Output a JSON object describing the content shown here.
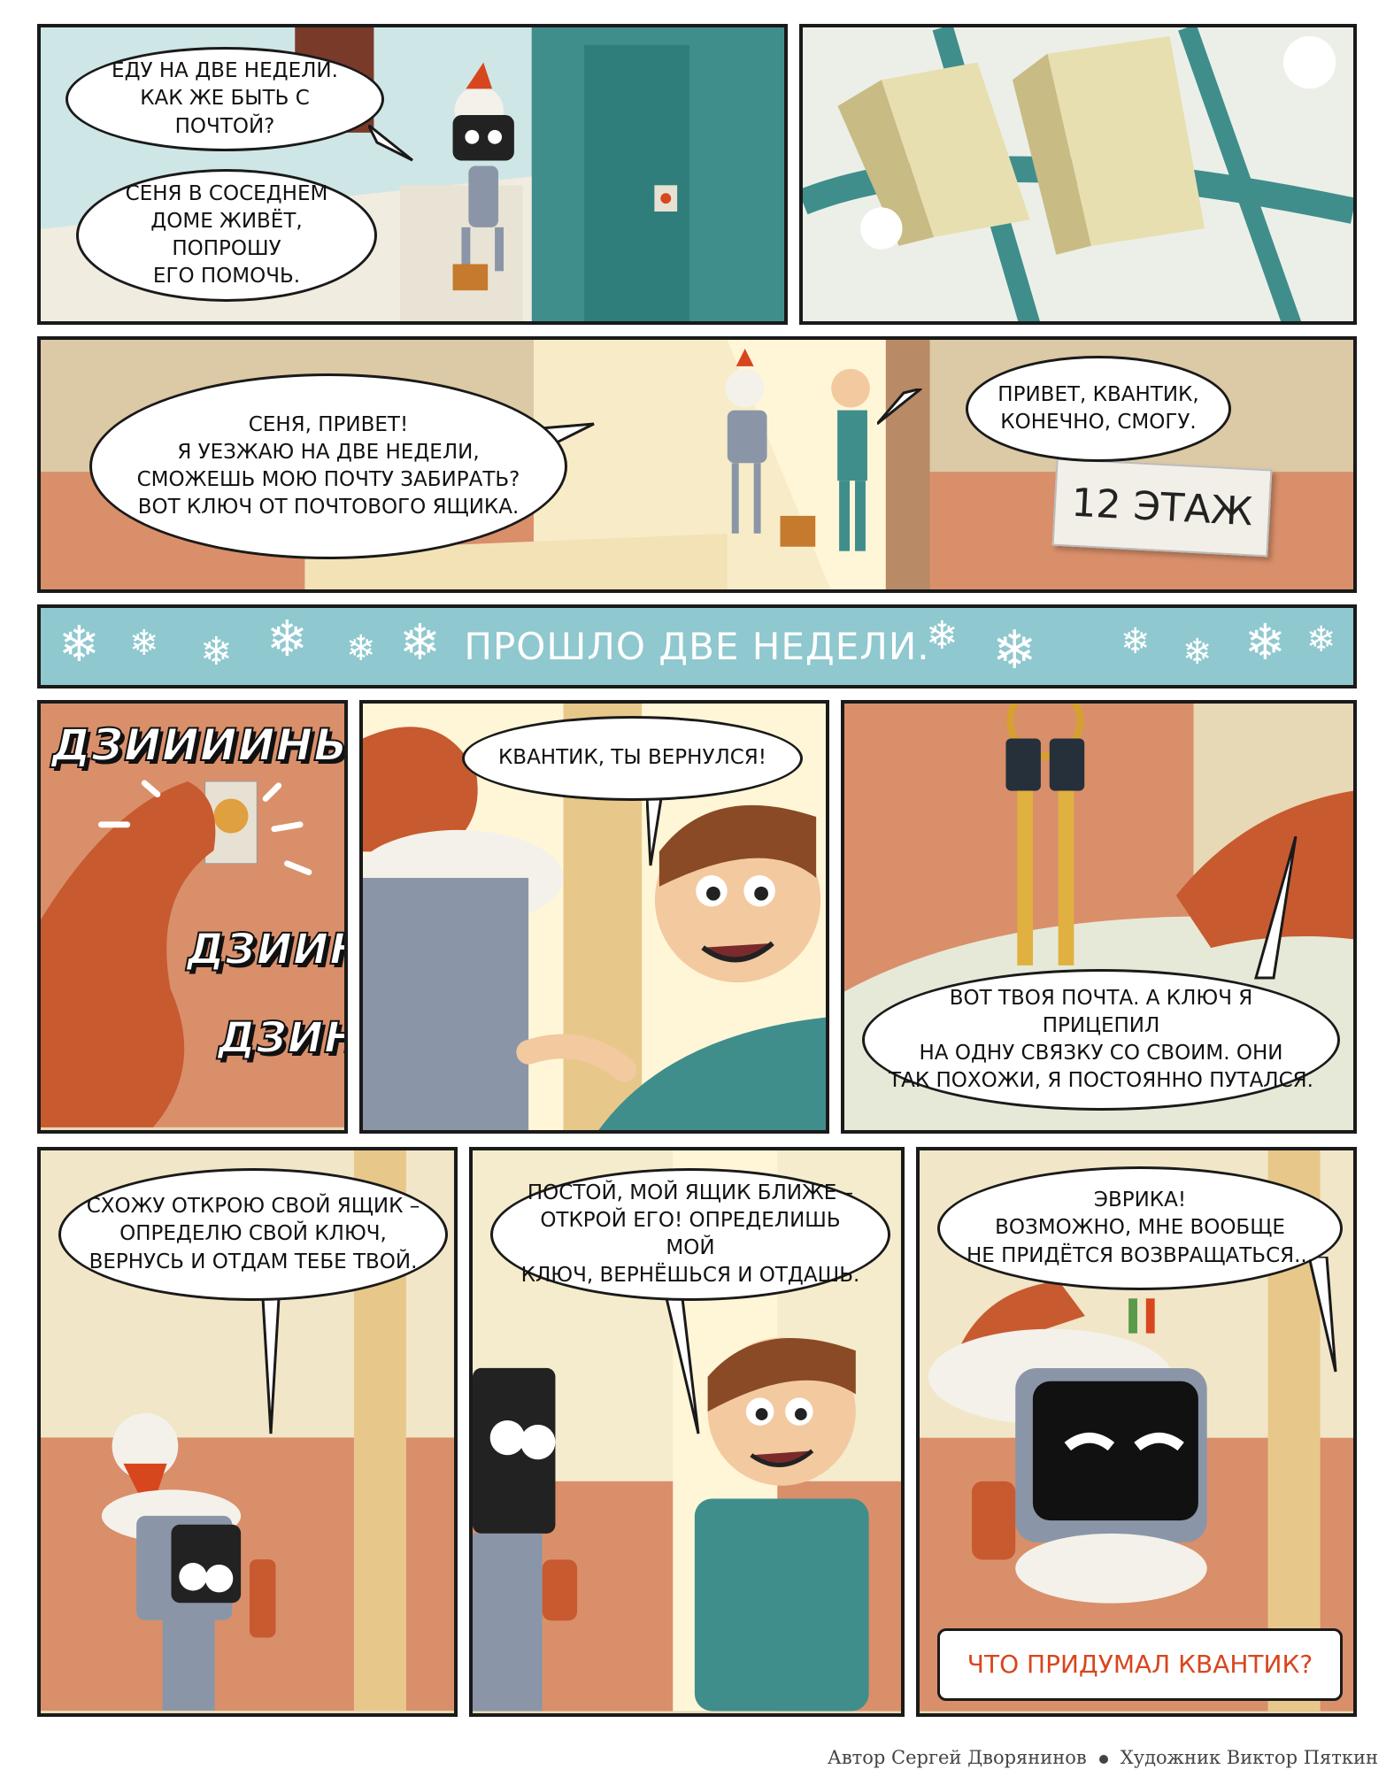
{
  "panels": {
    "p1": {
      "bubble1": "Еду на две недели.\nКак же быть с почтой?",
      "bubble2": "Сеня в соседнем\nдоме живёт, попрошу\nего помочь."
    },
    "p3": {
      "bubble1": "Сеня, привет!\nЯ уезжаю на две недели,\nсможешь мою почту забирать?\nВот ключ от почтового ящика.",
      "bubble2": "Привет, Квантик,\nконечно, смогу.",
      "sign": "12 этаж"
    },
    "banner": {
      "text": "Прошло две недели."
    },
    "p4": {
      "sfx1": "Дзиииинь!",
      "sfx2": "Дзиинь!",
      "sfx3": "Дзинь!"
    },
    "p5": {
      "bubble": "Квантик, ты вернулся!"
    },
    "p6": {
      "bubble": "Вот твоя почта. А ключ я прицепил\nна одну связку со своим. Они\nтак похожи, я постоянно путался."
    },
    "p7": {
      "bubble": "Схожу открою свой ящик –\nопределю свой ключ,\nвернусь и отдам тебе твой."
    },
    "p8": {
      "bubble": "Постой, мой ящик ближе –\nоткрой его! Определишь мой\nключ, вернёшься и отдашь."
    },
    "p9": {
      "bubble": "Эврика!\nВозможно, мне вообще\nне придётся возвращаться...",
      "caption": "Что придумал Квантик?"
    }
  },
  "credits": {
    "author": "Автор Сергей Дворянинов",
    "artist": "Художник Виктор Пяткин"
  },
  "colors": {
    "accent": "#d8461e",
    "banner": "#8fc8cf",
    "wall": "#d98f6a",
    "teal": "#3f8e8c"
  }
}
